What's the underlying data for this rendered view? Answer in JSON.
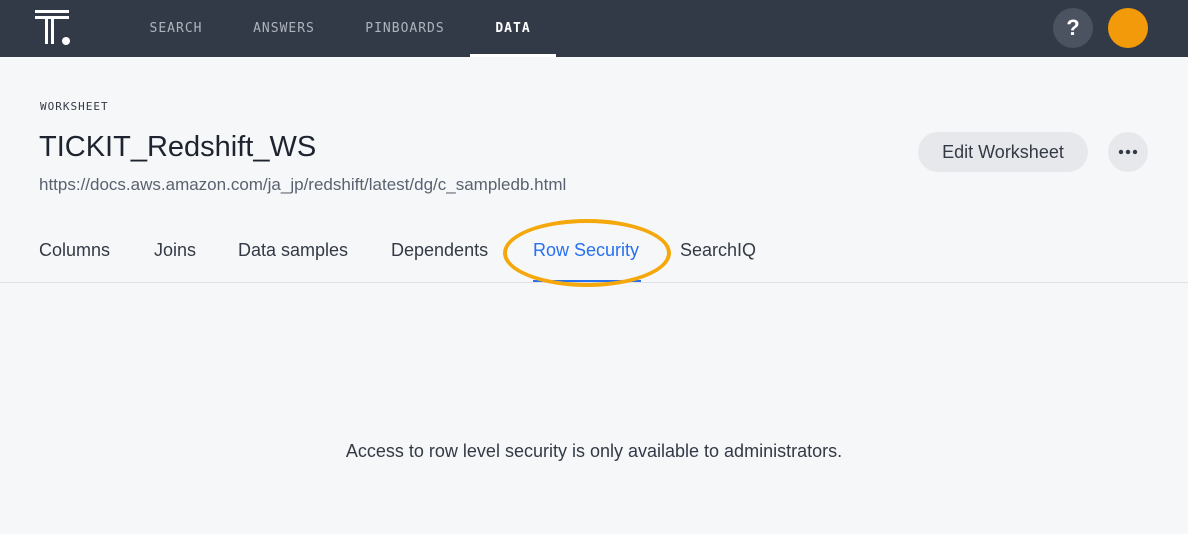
{
  "nav": {
    "items": [
      {
        "label": "SEARCH"
      },
      {
        "label": "ANSWERS"
      },
      {
        "label": "PINBOARDS"
      },
      {
        "label": "DATA",
        "active": true
      }
    ],
    "help_label": "?",
    "logo_icon": "thoughtspot-logo-icon",
    "avatar_color": "#f39a0b"
  },
  "header": {
    "type_label": "WORKSHEET",
    "title": "TICKIT_Redshift_WS",
    "description": "https://docs.aws.amazon.com/ja_jp/redshift/latest/dg/c_sampledb.html",
    "edit_label": "Edit Worksheet",
    "more_icon": "more-horizontal-icon"
  },
  "tabs": [
    {
      "label": "Columns"
    },
    {
      "label": "Joins"
    },
    {
      "label": "Data samples"
    },
    {
      "label": "Dependents"
    },
    {
      "label": "Row Security",
      "active": true
    },
    {
      "label": "SearchIQ"
    }
  ],
  "content": {
    "message": "Access to row level security is only available to administrators."
  },
  "colors": {
    "nav_bg": "#323a47",
    "accent": "#2770ef",
    "highlight": "#f5a80c",
    "background": "#f6f7f9"
  }
}
